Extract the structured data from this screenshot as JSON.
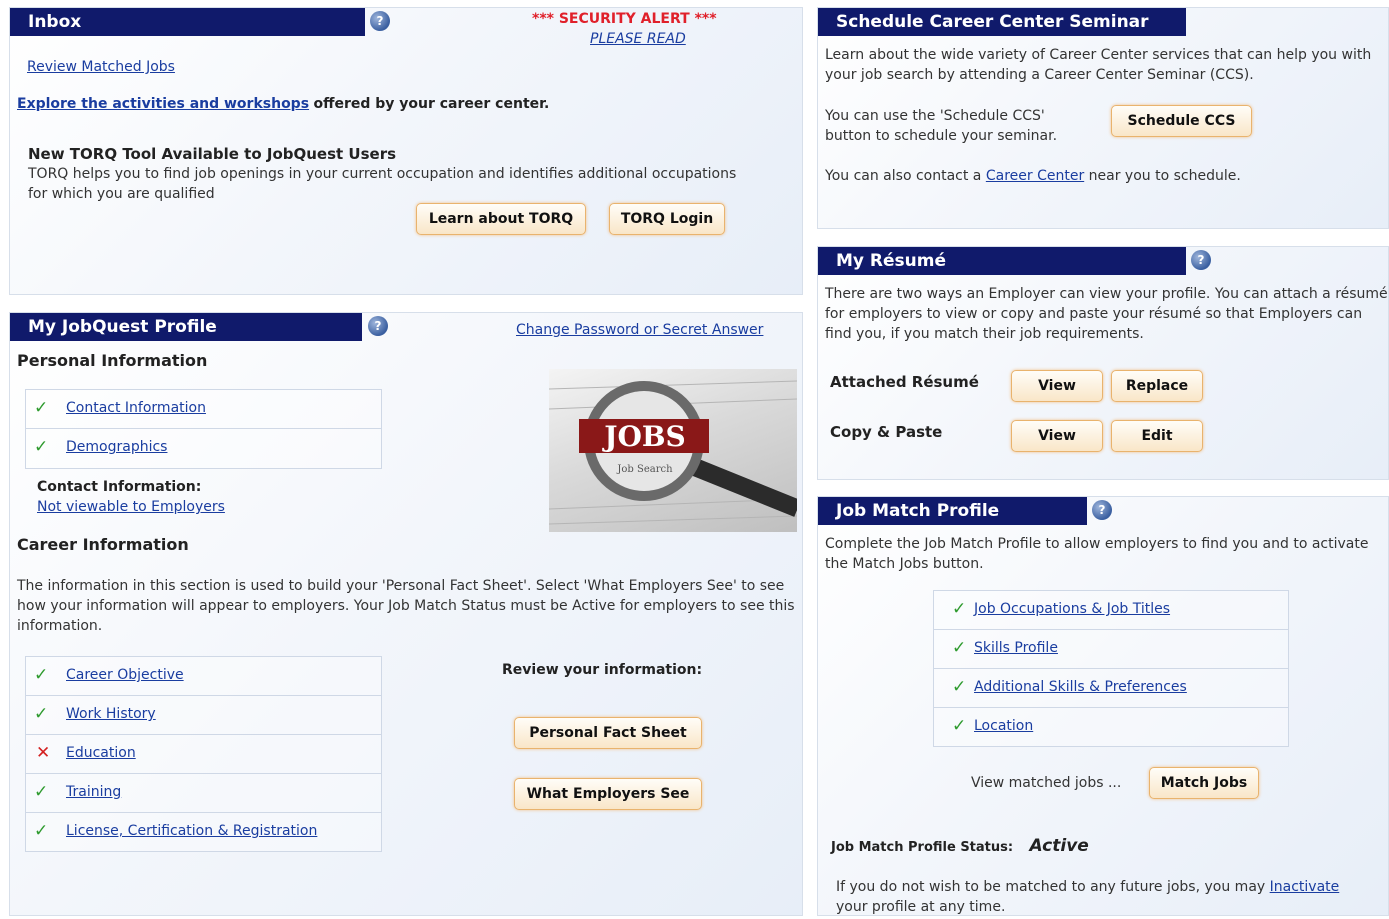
{
  "inbox": {
    "title": "Inbox",
    "security_alert": "*** SECURITY ALERT ***",
    "please_read": "PLEASE READ",
    "review_link": "Review Matched Jobs",
    "explore_link": "Explore the activities and workshops",
    "explore_rest": "offered by your career center.",
    "torq_heading": "New TORQ Tool Available to JobQuest Users",
    "torq_text": "TORQ helps you to find job openings in your current occupation and identifies additional occupations for which you are qualified",
    "learn_btn": "Learn about TORQ",
    "login_btn": "TORQ Login"
  },
  "profile": {
    "title": "My JobQuest Profile",
    "change_password": "Change Password or Secret Answer",
    "personal_heading": "Personal Information",
    "personal_items": [
      {
        "label": "Contact Information",
        "status": "complete"
      },
      {
        "label": "Demographics",
        "status": "complete"
      }
    ],
    "contact_label": "Contact Information:",
    "contact_link": "Not viewable to Employers",
    "image_word": "JOBS",
    "image_sub": "Job Search",
    "career_heading": "Career Information",
    "career_text": "The information in this section is used to build your 'Personal Fact Sheet'. Select 'What Employers See' to see how your information will appear to employers. Your Job Match Status must be Active for employers to see this information.",
    "career_items": [
      {
        "label": "Career Objective",
        "status": "complete"
      },
      {
        "label": "Work History",
        "status": "complete"
      },
      {
        "label": "Education",
        "status": "incomplete"
      },
      {
        "label": "Training",
        "status": "complete"
      },
      {
        "label": "License, Certification & Registration",
        "status": "complete"
      }
    ],
    "review_heading": "Review your information:",
    "fact_sheet_btn": "Personal Fact Sheet",
    "employers_see_btn": "What Employers See"
  },
  "seminar": {
    "title": "Schedule Career Center Seminar",
    "intro": "Learn about the wide variety of Career Center services that can help you with your job search by attending a Career Center Seminar (CCS).",
    "schedule_text": "You can use the 'Schedule CCS' button to schedule your seminar.",
    "schedule_btn": "Schedule CCS",
    "contact_pre": "You can also contact a",
    "contact_link": "Career Center",
    "contact_post": "near you to schedule."
  },
  "resume": {
    "title": "My Résumé",
    "text": "There are two ways an Employer can view your profile. You can attach a résumé for employers to view or copy and paste your résumé so that Employers can find you, if you match their job requirements.",
    "attached_label": "Attached Résumé",
    "copy_label": "Copy & Paste",
    "view_btn": "View",
    "replace_btn": "Replace",
    "edit_btn": "Edit"
  },
  "jobmatch": {
    "title": "Job Match Profile",
    "text": "Complete the Job Match Profile to allow employers to find you and to activate the Match Jobs button.",
    "items": [
      {
        "label": "Job Occupations & Job Titles",
        "status": "complete"
      },
      {
        "label": "Skills Profile",
        "status": "complete"
      },
      {
        "label": "Additional Skills & Preferences",
        "status": "complete"
      },
      {
        "label": "Location",
        "status": "complete"
      }
    ],
    "view_matched": "View matched jobs ...",
    "match_btn": "Match Jobs",
    "status_label": "Job Match Profile Status:",
    "status_value": "Active",
    "footer_pre": "If you do not wish to be matched to any future jobs, you may",
    "footer_link": "Inactivate",
    "footer_post": "your profile at any time."
  },
  "colors": {
    "title_bar": "#101a6b",
    "link": "#1a3da0",
    "alert": "#e0202a",
    "check": "#2f9b2f",
    "cross": "#d42020",
    "button_border": "#e9b36d"
  },
  "icons": {
    "help": "help-icon",
    "check": "check-icon",
    "cross": "cross-icon"
  }
}
